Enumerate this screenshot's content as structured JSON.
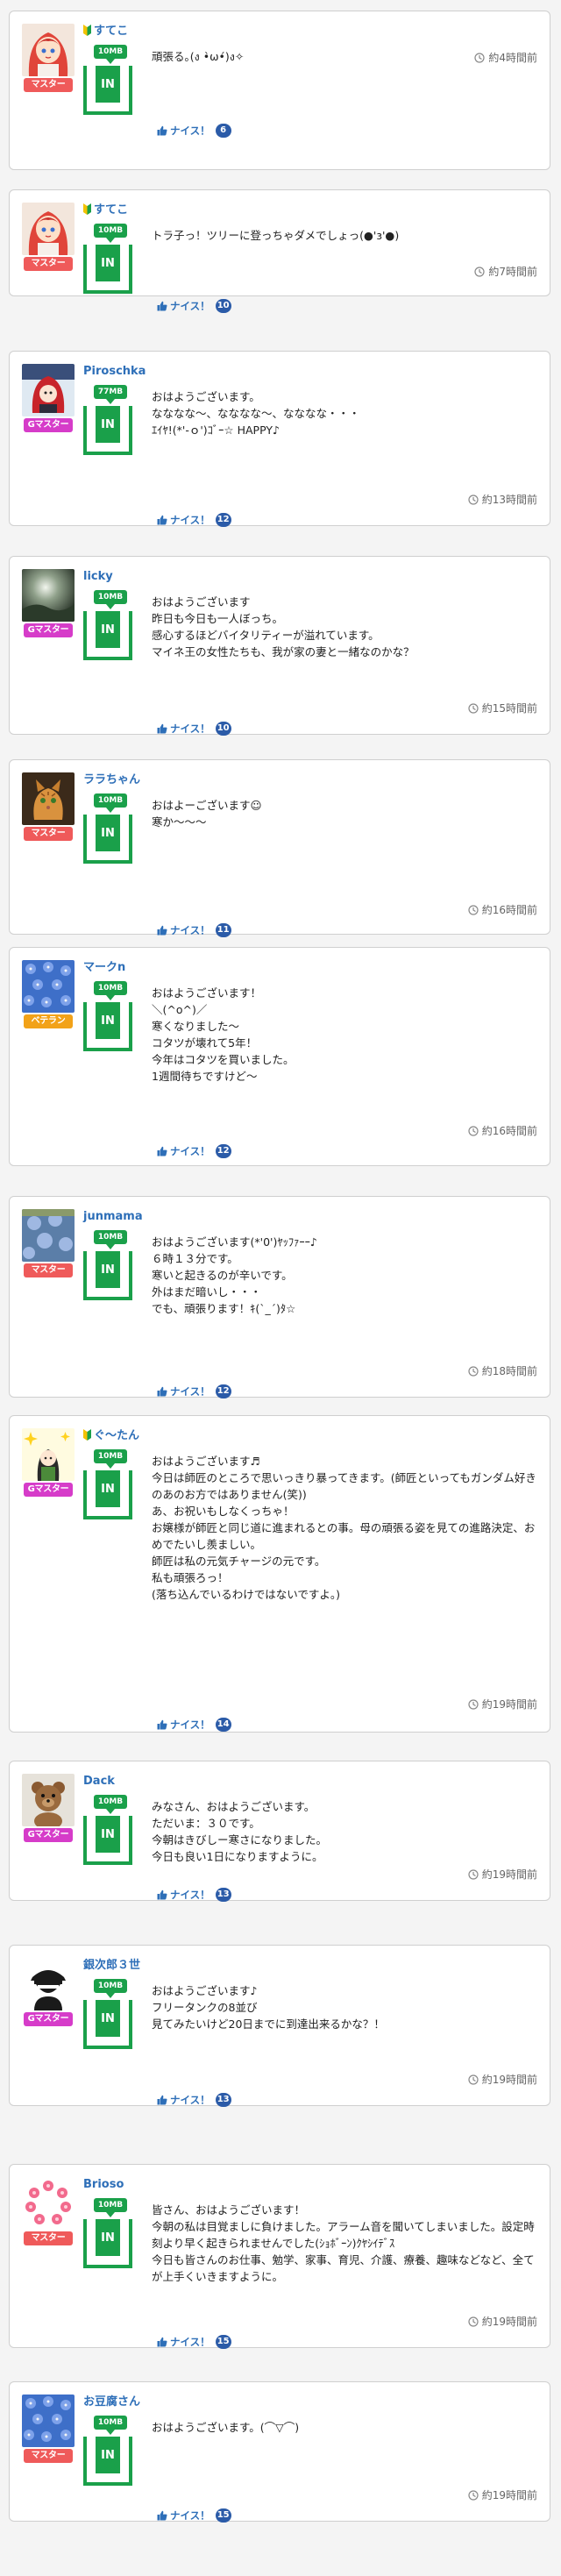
{
  "colors": {
    "rank_master": "#ef5a5a",
    "rank_gmaster": "#d63cc9",
    "rank_veteran": "#f2a218",
    "storage_green": "#1aa04a",
    "link_blue": "#2e6fb8",
    "count_badge": "#2b5ba8"
  },
  "nice_label": "ナイス！",
  "inbox_label": "IN",
  "posts": [
    {
      "user": "すてこ",
      "beginner": true,
      "avatar": "anime-girl-red-hair-avatar",
      "rank": "マスター",
      "rank_type": "master",
      "storage": "10MB",
      "lines": [
        "頑張る｡(ง •̀ω•́)ง✧"
      ],
      "time": "約4時間前",
      "nice": "6"
    },
    {
      "user": "すてこ",
      "beginner": true,
      "avatar": "anime-girl-red-hair-avatar",
      "rank": "マスター",
      "rank_type": "master",
      "storage": "10MB",
      "lines": [
        "トラ子っ！ツリーに登っちゃダメでしょっ(●'з'●)"
      ],
      "time": "約7時間前",
      "nice": "10"
    },
    {
      "user": "Piroschka",
      "beginner": false,
      "avatar": "red-hood-illustration-avatar",
      "rank": "Gマスター",
      "rank_type": "gmaster",
      "storage": "77MB",
      "lines": [
        "おはようございます。",
        "なななな～、なななな～、なななな・・・",
        "ｴｲﾔ!(*'-ｏ')ｺﾞｰ☆ HAPPY♪"
      ],
      "time": "約13時間前",
      "nice": "12"
    },
    {
      "user": "licky",
      "beginner": false,
      "avatar": "moonlit-landscape-avatar",
      "rank": "Gマスター",
      "rank_type": "gmaster",
      "storage": "10MB",
      "lines": [
        "おはようございます",
        "昨日も今日も一人ぼっち。",
        "感心するほどバイタリティーが溢れています。",
        "マイネ王の女性たちも、我が家の妻と一緒なのかな？"
      ],
      "time": "約15時間前",
      "nice": "10"
    },
    {
      "user": "ララちゃん",
      "beginner": false,
      "avatar": "tabby-cat-avatar",
      "rank": "マスター",
      "rank_type": "master",
      "storage": "10MB",
      "lines": [
        "おはよーございます☺",
        "寒か～～～"
      ],
      "time": "約16時間前",
      "nice": "11"
    },
    {
      "user": "マークn",
      "beginner": false,
      "avatar": "blue-flowers-avatar",
      "rank": "ベテラン",
      "rank_type": "veteran",
      "storage": "10MB",
      "lines": [
        "おはようございます！",
        "＼(^o^)／",
        "寒くなりました～",
        "コタツが壊れて5年！",
        "今年はコタツを買いました。",
        "1週間待ちですけど～"
      ],
      "time": "約16時間前",
      "nice": "12"
    },
    {
      "user": "junmama",
      "beginner": false,
      "avatar": "blue-flowers-photo-avatar",
      "rank": "マスター",
      "rank_type": "master",
      "storage": "10MB",
      "lines": [
        "おはようございます(*'0')ﾔｯﾌｧｰｰ♪",
        "６時１３分です。",
        "寒いと起きるのが辛いです。",
        "外はまだ暗いし・・・",
        "でも、頑張ります！ｷ(`_´)ﾀ☆"
      ],
      "time": "約18時間前",
      "nice": "12"
    },
    {
      "user": "ぐ～たん",
      "beginner": true,
      "avatar": "girl-with-sparkles-avatar",
      "rank": "Gマスター",
      "rank_type": "gmaster",
      "storage": "10MB",
      "lines": [
        "おはようございます♬",
        "今日は師匠のところで思いっきり暴ってきます。(師匠といってもガンダム好きのあのお方ではありません(笑))",
        "あ、お祝いもしなくっちゃ！",
        "お嬢様が師匠と同じ道に進まれるとの事。母の頑張る姿を見ての進路決定、おめでたいし羨ましい。",
        "師匠は私の元気チャージの元です。",
        "私も頑張ろっ！",
        "(落ち込んでいるわけではないですよ。)"
      ],
      "time": "約19時間前",
      "nice": "14"
    },
    {
      "user": "Dack",
      "beginner": false,
      "avatar": "teddy-bear-avatar",
      "rank": "Gマスター",
      "rank_type": "gmaster",
      "storage": "10MB",
      "lines": [
        "みなさん、おはようございます。",
        "ただいま：３０です。",
        "今朝はきびしー寒さになりました。",
        "今日も良い1日になりますように。"
      ],
      "time": "約19時間前",
      "nice": "13"
    },
    {
      "user": "銀次郎３世",
      "beginner": false,
      "avatar": "spy-character-avatar",
      "rank": "Gマスター",
      "rank_type": "gmaster",
      "storage": "10MB",
      "lines": [
        "おはようございます♪",
        "フリータンクの8並び",
        "見てみたいけど20日までに到達出来るかな？！"
      ],
      "time": "約19時間前",
      "nice": "13"
    },
    {
      "user": "Brioso",
      "beginner": false,
      "avatar": "flower-wreath-avatar",
      "rank": "マスター",
      "rank_type": "master",
      "storage": "10MB",
      "lines": [
        "皆さん、おはようございます！",
        "今朝の私は目覚ましに負けました。アラーム音を聞いてしまいました。設定時刻より早く起きられませんでした(ｼｮﾎﾞｰﾝ)ｸﾔｼｲﾃﾞｽ",
        "今日も皆さんのお仕事、勉学、家事、育児、介護、療養、趣味などなど、全てが上手くいきますように。"
      ],
      "time": "約19時間前",
      "nice": "15"
    },
    {
      "user": "お豆腐さん",
      "beginner": false,
      "avatar": "blue-flowers-avatar",
      "rank": "マスター",
      "rank_type": "master",
      "storage": "10MB",
      "lines": [
        "おはようございます。(⌒▽⌒)"
      ],
      "time": "約19時間前",
      "nice": "15"
    }
  ]
}
